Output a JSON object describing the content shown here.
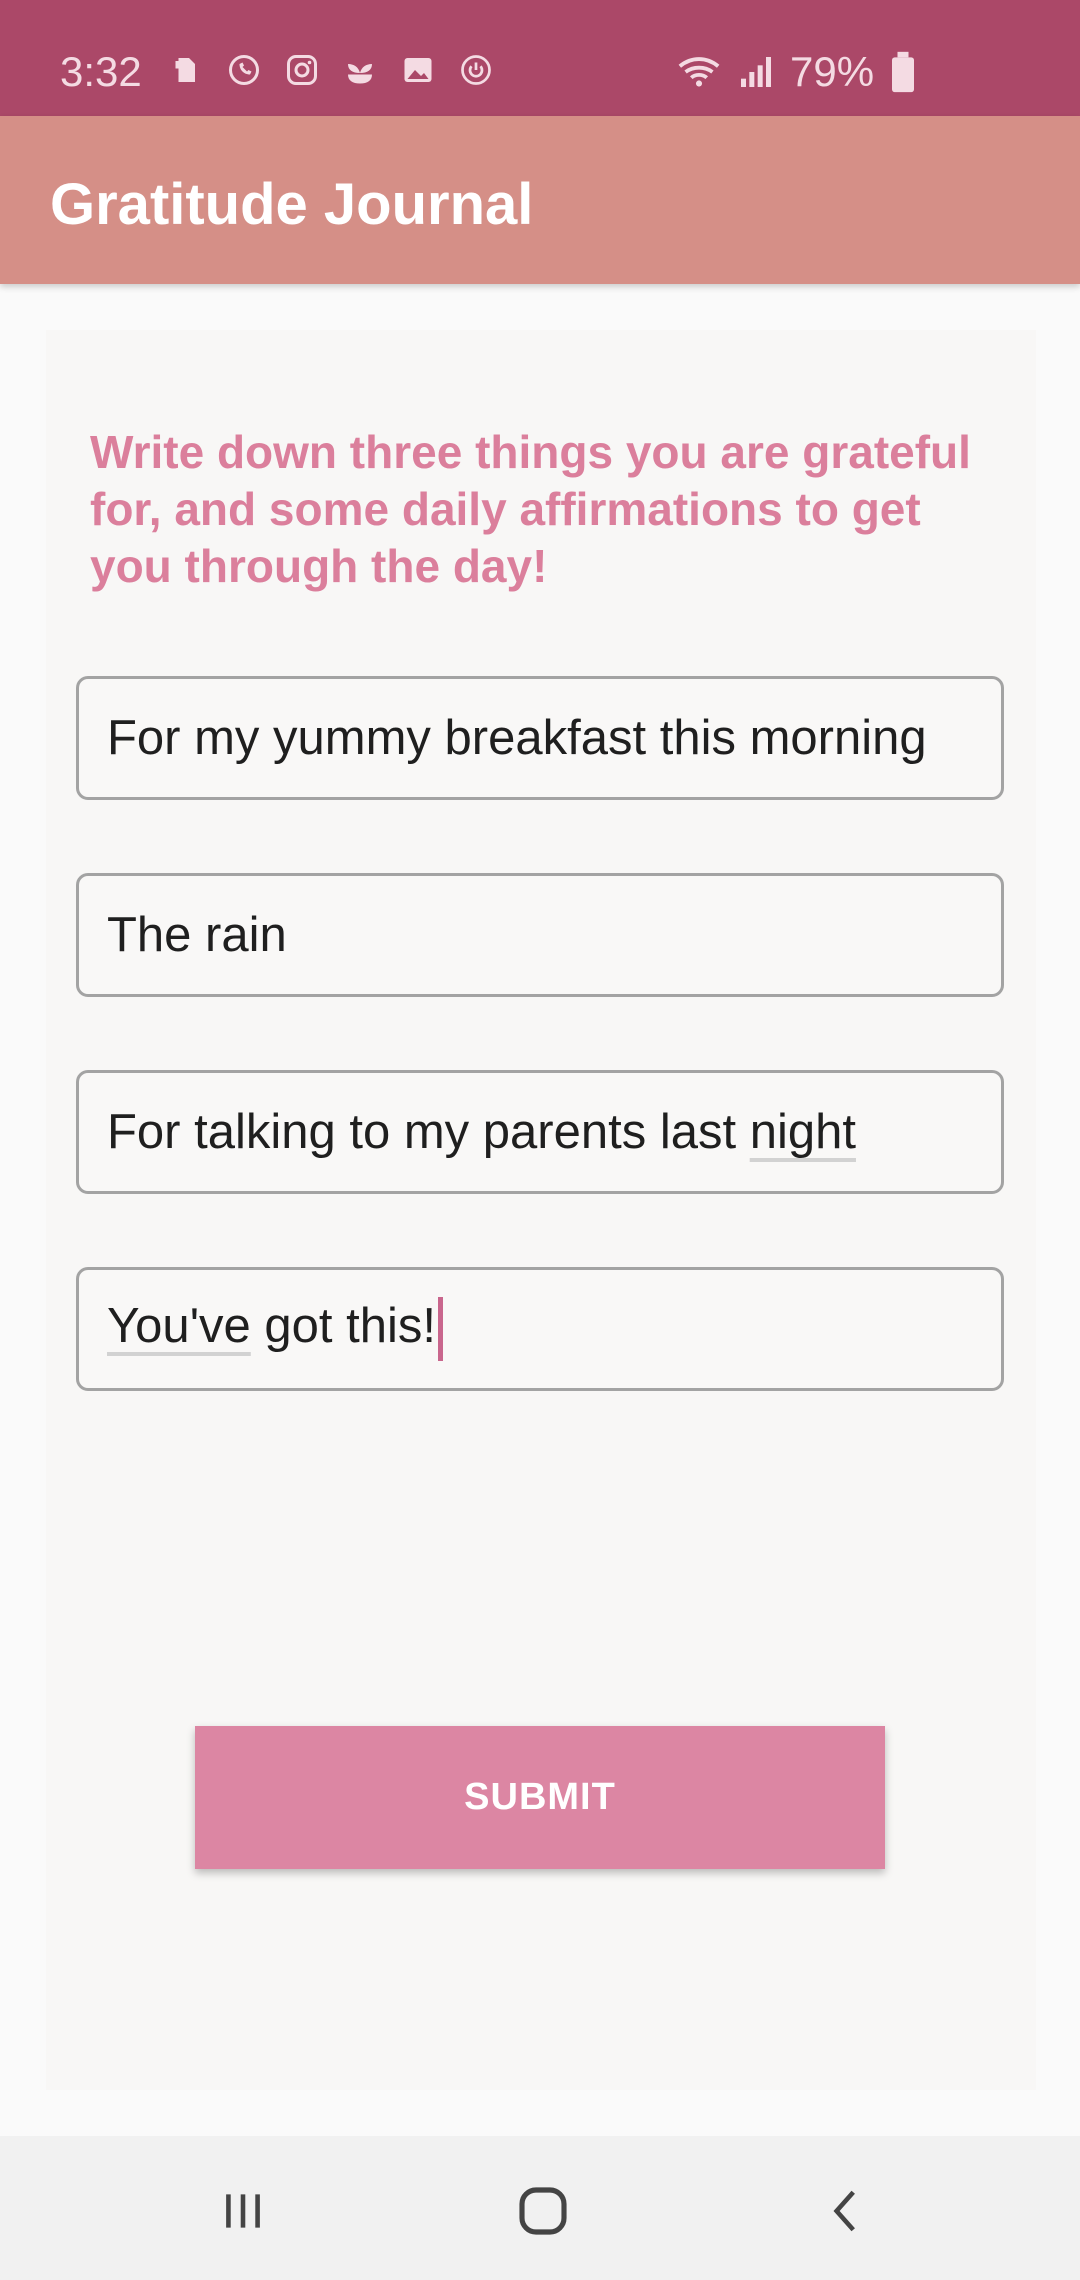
{
  "status_bar": {
    "time": "3:32",
    "battery": "79%",
    "left_icons": [
      "evernote-icon",
      "whatsapp-icon",
      "instagram-icon",
      "sprout-icon",
      "gallery-icon",
      "power-icon"
    ],
    "right_icons": [
      "wifi-icon",
      "signal-icon",
      "battery-icon"
    ]
  },
  "app_bar": {
    "title": "Gratitude Journal"
  },
  "main": {
    "prompt": "Write down three things you are grateful for, and some daily affirmations to get you through the day!",
    "fields": [
      {
        "value": "For my yummy breakfast this morning"
      },
      {
        "value": "The rain"
      },
      {
        "value_a": "For talking to my parents last ",
        "value_b": "night"
      },
      {
        "value_a": "You've",
        "value_b": " got this!"
      }
    ],
    "submit_label": "SUBMIT"
  },
  "nav_bar": {
    "buttons": [
      "recents-icon",
      "home-icon",
      "back-icon"
    ]
  },
  "colors": {
    "status_bar": "#ab4868",
    "app_bar": "#d58f87",
    "accent": "#db7f9c",
    "button": "#dc86a3"
  }
}
